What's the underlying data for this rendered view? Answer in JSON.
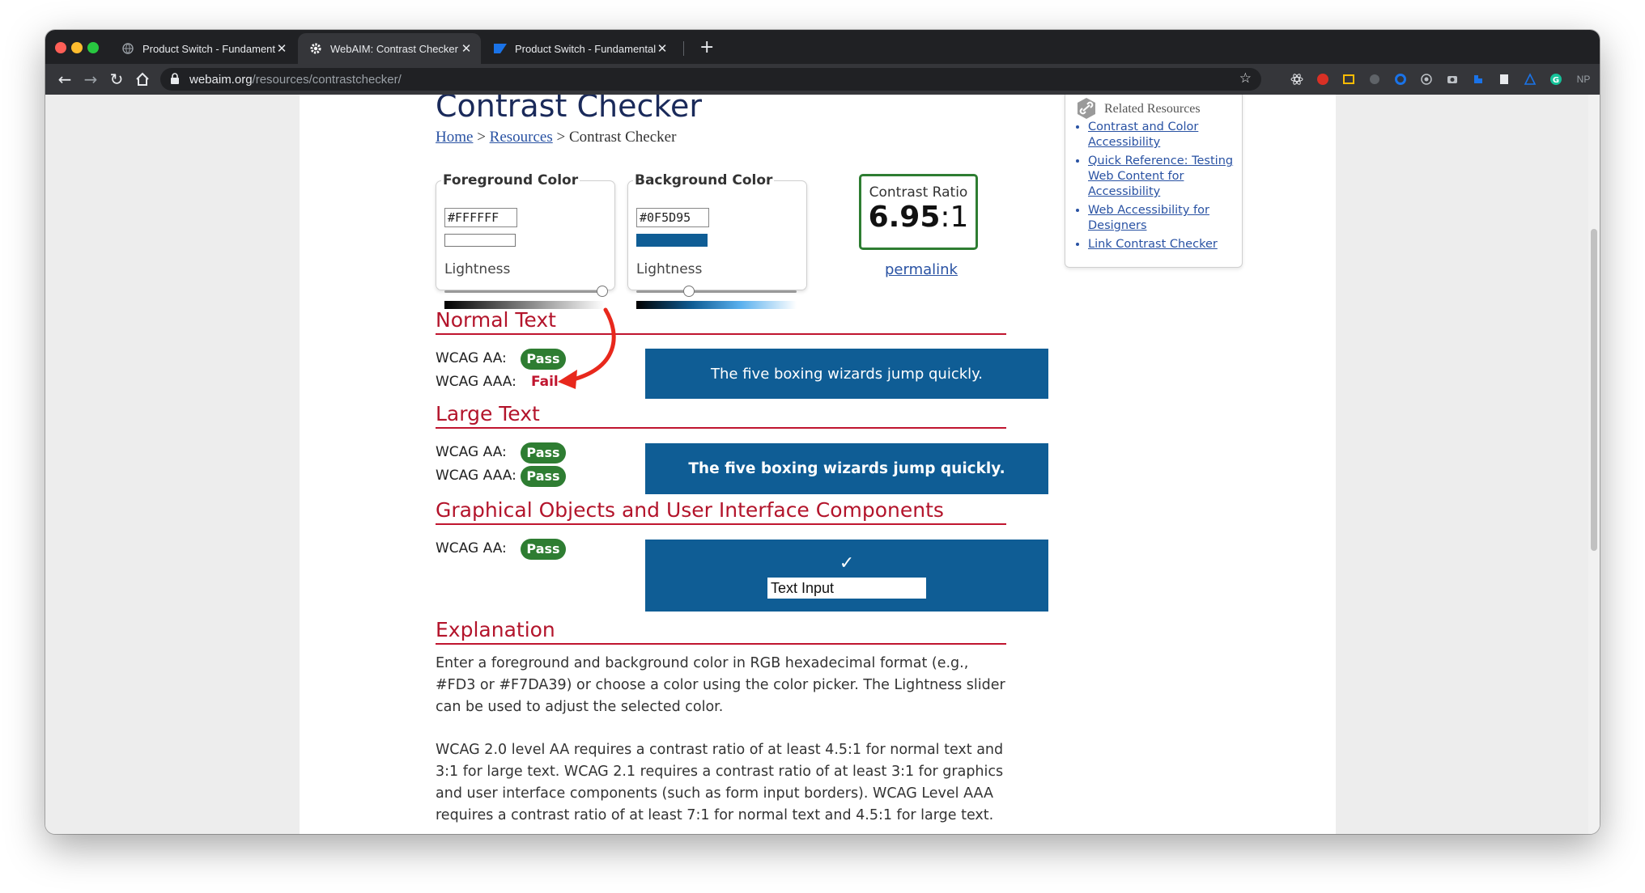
{
  "browser": {
    "tabs": [
      {
        "title": "Product Switch - Fundamental",
        "active": false
      },
      {
        "title": "WebAIM: Contrast Checker",
        "active": true
      },
      {
        "title": "Product Switch - Fundamental",
        "active": false
      }
    ],
    "new_tab": "+",
    "url_host": "webaim.org",
    "url_path": "/resources/contrastchecker/",
    "profile_badge": "NP"
  },
  "page": {
    "title": "Contrast Checker",
    "breadcrumb": {
      "home": "Home",
      "sep1": ">",
      "resources": "Resources",
      "sep2": ">",
      "current": "Contrast Checker"
    },
    "foreground": {
      "legend": "Foreground Color",
      "hex": "#FFFFFF",
      "lightness_label": "Lightness",
      "lightness": 1.0,
      "swatch_color": "#ffffff"
    },
    "background": {
      "legend": "Background Color",
      "hex": "#0F5D95",
      "lightness_label": "Lightness",
      "lightness": 0.33,
      "swatch_color": "#0f5d95"
    },
    "contrast": {
      "label": "Contrast Ratio",
      "value": "6.95",
      "suffix": ":1",
      "permalink": "permalink"
    },
    "normal_text": {
      "heading": "Normal Text",
      "aa_label": "WCAG AA:",
      "aa_result": "Pass",
      "aaa_label": "WCAG AAA:",
      "aaa_result": "Fail",
      "sample": "The five boxing wizards jump quickly."
    },
    "large_text": {
      "heading": "Large Text",
      "aa_label": "WCAG AA:",
      "aa_result": "Pass",
      "aaa_label": "WCAG AAA:",
      "aaa_result": "Pass",
      "sample": "The five boxing wizards jump quickly."
    },
    "graphical": {
      "heading": "Graphical Objects and User Interface Components",
      "aa_label": "WCAG AA:",
      "aa_result": "Pass",
      "checkmark": "✓",
      "input_value": "Text Input"
    },
    "explanation": {
      "heading": "Explanation",
      "p1": "Enter a foreground and background color in RGB hexadecimal format (e.g., #FD3 or #F7DA39) or choose a color using the color picker. The Lightness slider can be used to adjust the selected color.",
      "p2": "WCAG 2.0 level AA requires a contrast ratio of at least 4.5:1 for normal text and 3:1 for large text. WCAG 2.1 requires a contrast ratio of at least 3:1 for graphics and user interface components (such as form input borders). WCAG Level AAA requires a contrast ratio of at least 7:1 for normal text and 4.5:1 for large text."
    },
    "related": {
      "heading": "Related Resources",
      "links": [
        "Contrast and Color Accessibility",
        "Quick Reference: Testing Web Content for Accessibility",
        "Web Accessibility for Designers",
        "Link Contrast Checker"
      ]
    }
  },
  "colors": {
    "pass": "#2e7d32",
    "fail": "#c0152f",
    "heading": "#b3142b",
    "link": "#2952a3",
    "annotation_arrow": "#e8281c"
  }
}
